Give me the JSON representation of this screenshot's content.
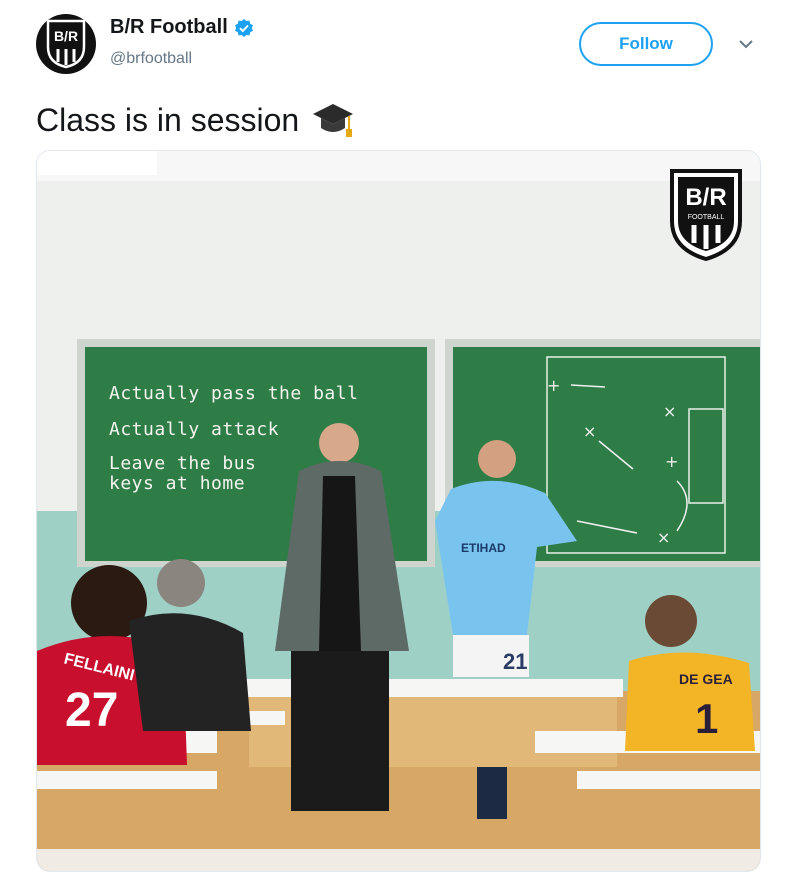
{
  "account": {
    "name": "B/R Football",
    "handle": "@brfootball",
    "avatar_text": "B/R",
    "verified": true
  },
  "follow_button": {
    "label": "Follow"
  },
  "tweet": {
    "text": "Class is in session",
    "emoji_icon": "graduation-cap-icon"
  },
  "media": {
    "logo_text": "B/R",
    "logo_subtext": "FOOTBALL",
    "chalkboard_lines": [
      "Actually pass the ball",
      "Actually attack",
      "Leave the bus",
      "keys at home"
    ],
    "jerseys": {
      "fellaini_name": "FELLAINI",
      "fellaini_number": "27",
      "degea_name": "DE GEA",
      "degea_number": "1",
      "silva_number": "21",
      "silva_sponsor": "ETIHAD"
    }
  },
  "colors": {
    "accent": "#1da1f2",
    "text_primary": "#14171a",
    "text_secondary": "#657786",
    "chalkboard": "#2e7d45"
  }
}
